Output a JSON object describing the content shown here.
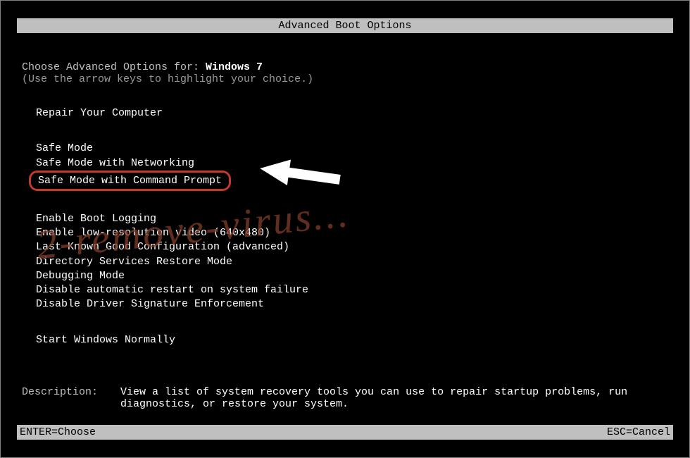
{
  "title": "Advanced Boot Options",
  "choose_prefix": "Choose Advanced Options for: ",
  "os_name": "Windows 7",
  "instruction": "(Use the arrow keys to highlight your choice.)",
  "menu": {
    "repair": "Repair Your Computer",
    "safe_mode": "Safe Mode",
    "safe_mode_networking": "Safe Mode with Networking",
    "safe_mode_cmd": "Safe Mode with Command Prompt",
    "boot_logging": "Enable Boot Logging",
    "low_res": "Enable low-resolution video (640x480)",
    "last_known": "Last Known Good Configuration (advanced)",
    "dsrm": "Directory Services Restore Mode",
    "debug": "Debugging Mode",
    "no_auto_restart": "Disable automatic restart on system failure",
    "no_driver_sig": "Disable Driver Signature Enforcement",
    "start_normally": "Start Windows Normally"
  },
  "description": {
    "label": "Description:",
    "text": "View a list of system recovery tools you can use to repair startup problems, run diagnostics, or restore your system."
  },
  "footer": {
    "enter": "ENTER=Choose",
    "esc": "ESC=Cancel"
  },
  "watermark": "2-remove-virus...",
  "annotation": {
    "highlight_color": "#c23a2a",
    "arrow_color": "#ffffff"
  }
}
